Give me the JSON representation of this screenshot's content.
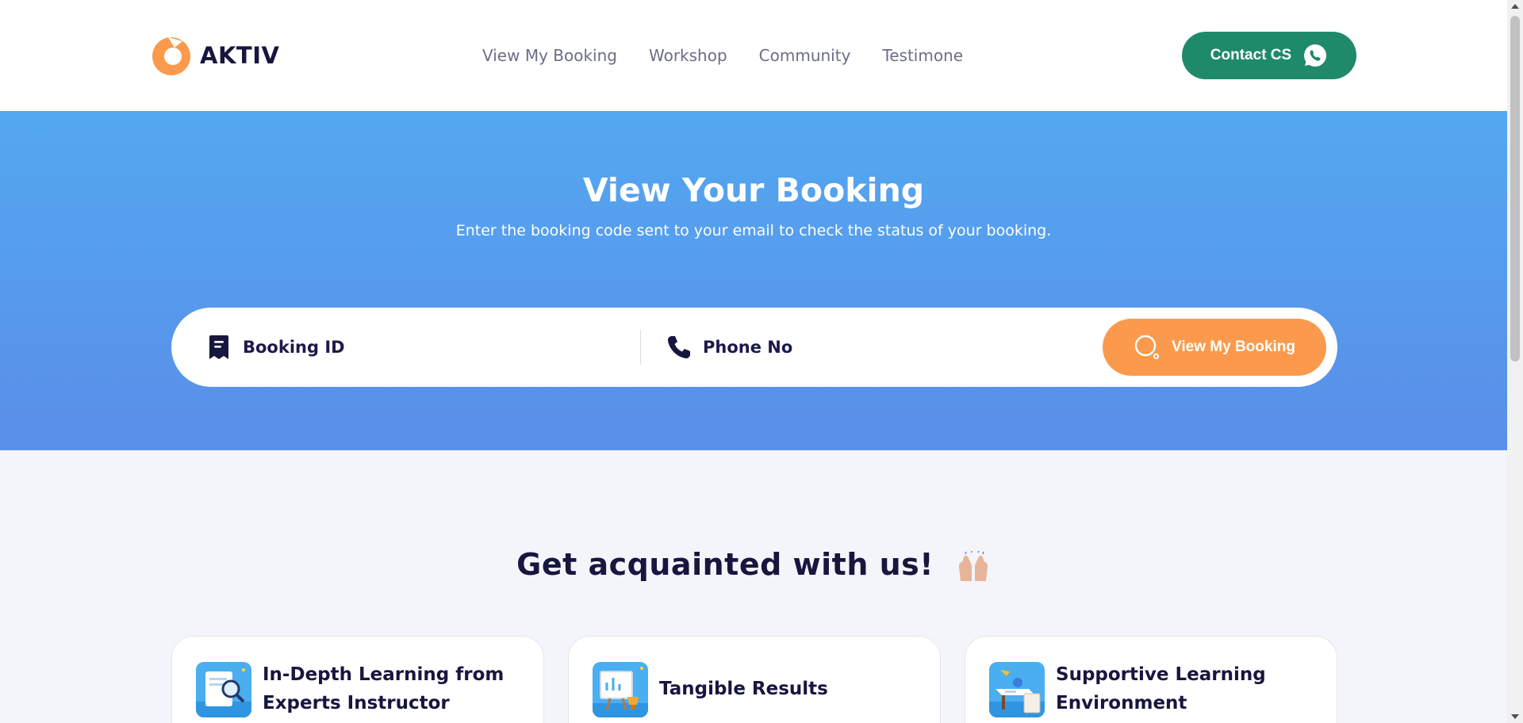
{
  "header": {
    "logo_text": "AKTIV",
    "nav": [
      {
        "label": "View My Booking"
      },
      {
        "label": "Workshop"
      },
      {
        "label": "Community"
      },
      {
        "label": "Testimone"
      }
    ],
    "contact_label": "Contact CS",
    "contact_icon": "whatsapp-icon"
  },
  "hero": {
    "title": "View Your Booking",
    "subtitle": "Enter the booking code sent to your email to check the status of your booking.",
    "booking_field": {
      "placeholder": "Booking ID",
      "value": "",
      "icon": "receipt-icon"
    },
    "phone_field": {
      "placeholder": "Phone No",
      "value": "",
      "icon": "phone-icon"
    },
    "submit_label": "View My Booking",
    "submit_icon": "search-icon"
  },
  "about": {
    "title": "Get acquainted with us!",
    "title_icon": "raising-hands-emoji",
    "cards": [
      {
        "title": "In-Depth Learning from Experts Instructor",
        "icon": "magnifier-document-icon"
      },
      {
        "title": "Tangible Results",
        "icon": "whiteboard-trophy-icon"
      },
      {
        "title": "Supportive Learning Environment",
        "icon": "desk-workspace-icon"
      }
    ]
  },
  "colors": {
    "brand_orange": "#fb9a4c",
    "contact_green": "#1f8a6a",
    "hero_top": "#53a8f1",
    "hero_bottom": "#5a8ee8",
    "text_dark": "#17163f"
  }
}
